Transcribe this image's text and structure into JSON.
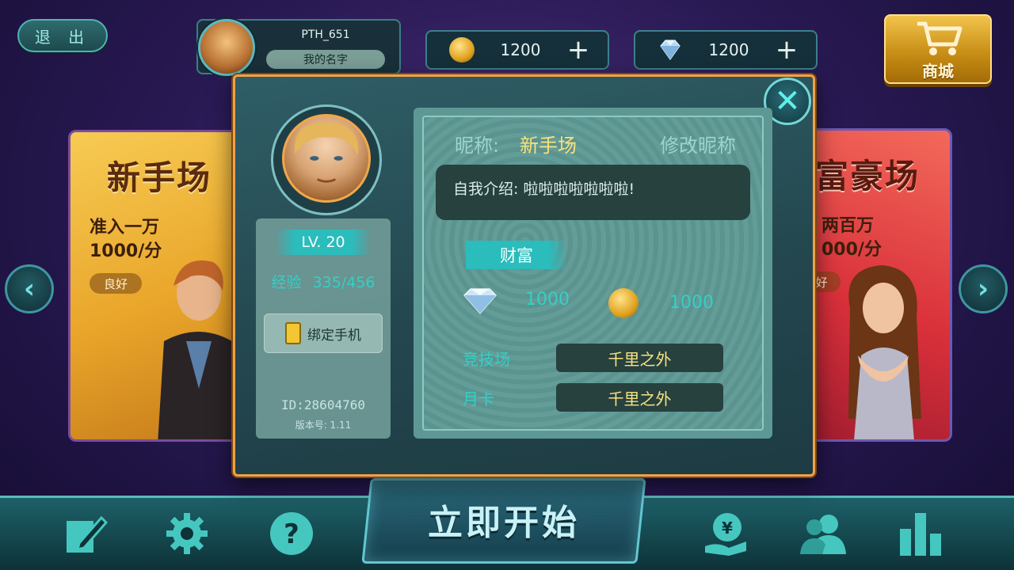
{
  "topbar": {
    "exit_label": "退 出",
    "profile_name": "PTH_651",
    "profile_tag": "我的名字",
    "coins": "1200",
    "diamonds": "1200",
    "plus": "+",
    "shop_label": "商城"
  },
  "left_card": {
    "title": "新手场",
    "line1": "准入一万",
    "line2": "1000/分",
    "badge": "良好"
  },
  "right_card": {
    "title": "富豪场",
    "line1": "两百万",
    "line2": "000/分",
    "badge": "好"
  },
  "nav": {
    "left_arrow": "‹",
    "right_arrow": "›"
  },
  "bottom": {
    "start_label": "立即开始"
  },
  "modal": {
    "close": "✕",
    "level": "LV. 20",
    "exp_label": "经验",
    "exp_value": "335/456",
    "bind_phone": "绑定手机",
    "id": "ID:28604760",
    "version": "版本号: 1.11",
    "nickname_label": "昵称:",
    "nickname_value": "新手场",
    "edit_nickname": "修改昵称",
    "intro": "自我介绍: 啦啦啦啦啦啦啦!",
    "wealth_label": "财富",
    "diamond_value": "1000",
    "coin_value": "1000",
    "arena_label": "竞技场",
    "arena_value": "千里之外",
    "monthcard_label": "月卡",
    "monthcard_value": "千里之外"
  },
  "colors": {
    "accent_teal": "#35cfc6",
    "modal_border": "#f1a146",
    "gold_text": "#f7e27e"
  },
  "icons": [
    "coin-icon",
    "diamond-icon",
    "cart-icon",
    "edit-icon",
    "gear-icon",
    "help-icon",
    "money-icon",
    "friends-icon",
    "rank-icon",
    "phone-icon",
    "close-icon"
  ]
}
